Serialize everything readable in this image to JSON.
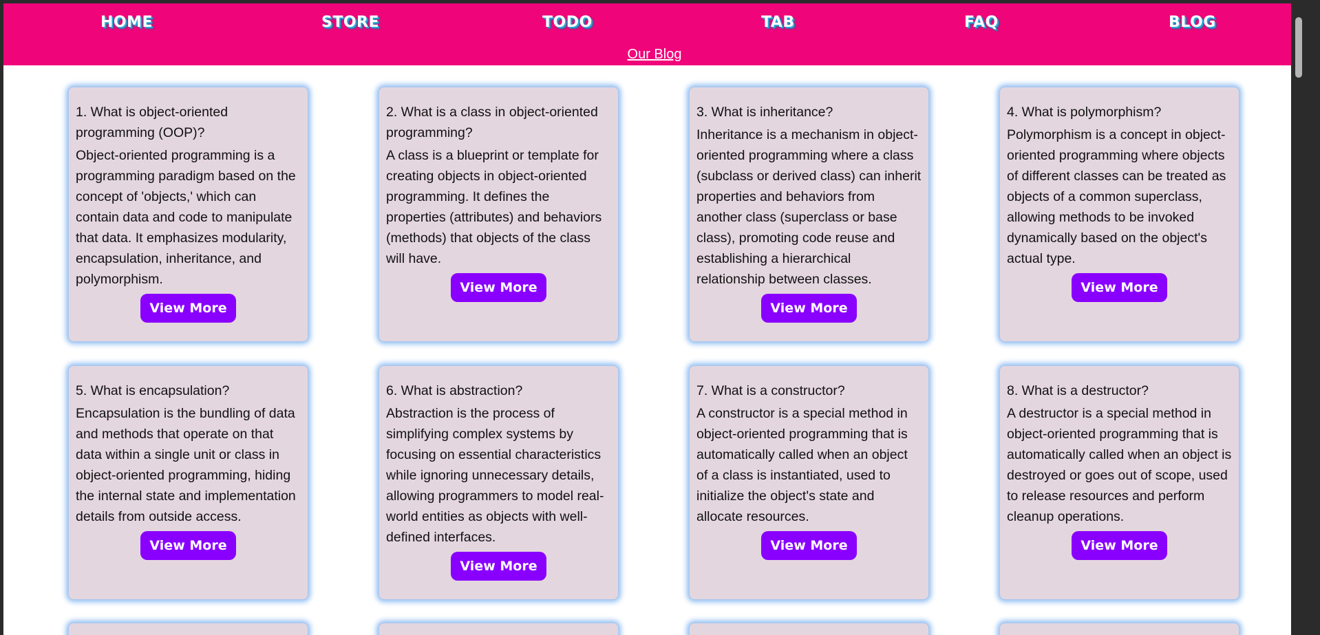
{
  "nav": {
    "items": [
      {
        "label": "HOME"
      },
      {
        "label": "STORE"
      },
      {
        "label": "TODO"
      },
      {
        "label": "TAB"
      },
      {
        "label": "FAQ"
      },
      {
        "label": "BLOG"
      }
    ],
    "sub_link": "Our Blog"
  },
  "cards": [
    {
      "title": "1. What is object-oriented programming (OOP)?",
      "body": "Object-oriented programming is a programming paradigm based on the concept of 'objects,' which can contain data and code to manipulate that data. It emphasizes modularity, encapsulation, inheritance, and polymorphism.",
      "button": "View More"
    },
    {
      "title": "2. What is a class in object-oriented programming?",
      "body": "A class is a blueprint or template for creating objects in object-oriented programming. It defines the properties (attributes) and behaviors (methods) that objects of the class will have.",
      "button": "View More"
    },
    {
      "title": "3. What is inheritance?",
      "body": "Inheritance is a mechanism in object-oriented programming where a class (subclass or derived class) can inherit properties and behaviors from another class (superclass or base class), promoting code reuse and establishing a hierarchical relationship between classes.",
      "button": "View More"
    },
    {
      "title": "4. What is polymorphism?",
      "body": "Polymorphism is a concept in object-oriented programming where objects of different classes can be treated as objects of a common superclass, allowing methods to be invoked dynamically based on the object's actual type.",
      "button": "View More"
    },
    {
      "title": "5. What is encapsulation?",
      "body": "Encapsulation is the bundling of data and methods that operate on that data within a single unit or class in object-oriented programming, hiding the internal state and implementation details from outside access.",
      "button": "View More"
    },
    {
      "title": "6. What is abstraction?",
      "body": "Abstraction is the process of simplifying complex systems by focusing on essential characteristics while ignoring unnecessary details, allowing programmers to model real-world entities as objects with well-defined interfaces.",
      "button": "View More"
    },
    {
      "title": "7. What is a constructor?",
      "body": "A constructor is a special method in object-oriented programming that is automatically called when an object of a class is instantiated, used to initialize the object's state and allocate resources.",
      "button": "View More"
    },
    {
      "title": "8. What is a destructor?",
      "body": "A destructor is a special method in object-oriented programming that is automatically called when an object is destroyed or goes out of scope, used to release resources and perform cleanup operations.",
      "button": "View More"
    }
  ]
}
